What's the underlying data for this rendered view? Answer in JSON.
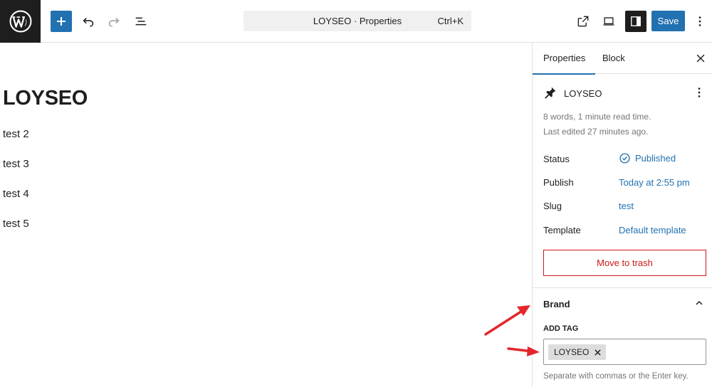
{
  "toolbar": {
    "command_bar_text": "LOYSEO · Properties",
    "command_shortcut": "Ctrl+K",
    "save_label": "Save"
  },
  "canvas": {
    "title": "LOYSEO",
    "paragraphs": [
      "test 2",
      "test 3",
      "test 4",
      "test 5"
    ]
  },
  "sidebar": {
    "tabs": [
      {
        "label": "Properties",
        "active": true
      },
      {
        "label": "Block",
        "active": false
      }
    ],
    "post": {
      "title": "LOYSEO",
      "meta_words": "8 words, 1 minute read time.",
      "meta_edited": "Last edited 27 minutes ago."
    },
    "rows": [
      {
        "label": "Status",
        "value": "Published"
      },
      {
        "label": "Publish",
        "value": "Today at 2:55 pm"
      },
      {
        "label": "Slug",
        "value": "test"
      },
      {
        "label": "Template",
        "value": "Default template"
      }
    ],
    "trash_label": "Move to trash",
    "brand_panel": {
      "title": "Brand",
      "add_tag_label": "ADD TAG",
      "tags": [
        "LOYSEO"
      ],
      "help": "Separate with commas or the Enter key."
    }
  },
  "colors": {
    "accent": "#2271b1",
    "danger": "#cc1818",
    "annotation_arrow": "#e3262b"
  },
  "icons": [
    "wordpress-logo",
    "plus-icon",
    "undo-icon",
    "redo-icon",
    "list-view-icon",
    "external-view-icon",
    "device-preview-icon",
    "sidebar-toggle-icon",
    "more-vertical-icon",
    "close-icon",
    "pin-icon",
    "check-circle-icon",
    "chevron-up-icon"
  ]
}
